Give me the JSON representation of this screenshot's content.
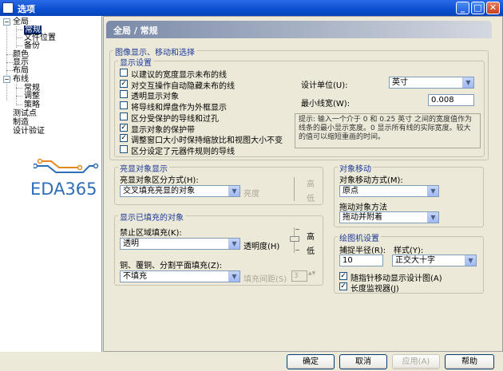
{
  "window": {
    "title": "选项"
  },
  "titlebar_buttons": {
    "minimize": "_",
    "maximize": "□",
    "close": "✕"
  },
  "tree": {
    "global": "全局",
    "general": "常规",
    "file_location": "文件位置",
    "backup": "备份",
    "color": "颜色",
    "display": "显示",
    "layer": "布局",
    "routing": "布线",
    "routing_general": "常规",
    "routing_adjust": "调整",
    "routing_strategy": "策略",
    "testpoint": "测试点",
    "fab": "制造",
    "design_verify": "设计验证",
    "expand_minus": "−"
  },
  "logo": {
    "text": "EDA365"
  },
  "panel": {
    "title": "全局 / 常规"
  },
  "image_group": {
    "title": "图像显示、移动和选择",
    "display_settings": {
      "title": "显示设置",
      "checkboxes": [
        {
          "label": "以建议的宽度显示未布的线",
          "checked": false
        },
        {
          "label": "对交互操作自动隐藏未布的线",
          "checked": true
        },
        {
          "label": "透明显示对象",
          "checked": false
        },
        {
          "label": "将导线和焊盘作为外框显示",
          "checked": false
        },
        {
          "label": "区分受保护的导线和过孔",
          "checked": false
        },
        {
          "label": "显示对象的保护带",
          "checked": true
        },
        {
          "label": "调整窗口大小时保持缩放比和视图大小不变",
          "checked": true
        },
        {
          "label": "区分设定了元器件规则的导线",
          "checked": false
        }
      ],
      "design_unit_label": "设计单位(U):",
      "design_unit_value": "英寸",
      "min_width_label": "最小线宽(W):",
      "min_width_value": "0.008",
      "hint": "提示: 输入一个介于 0 和 0.25 英寸 之间的宽度值作为线条的最小显示宽度。0 显示所有线的实际宽度。较大的值可以缩短重画的时间。"
    }
  },
  "highlight": {
    "title": "亮显对象显示",
    "mode_label": "亮显对象区分方式(H):",
    "mode_value": "交叉填充亮显的对象",
    "brightness_label": "亮度",
    "high": "高",
    "low": "低"
  },
  "object_move": {
    "title": "对象移动",
    "mode_label": "对象移动方式(M):",
    "mode_value": "原点",
    "drag_label": "拖动对象方法",
    "drag_value": "拖动并附着"
  },
  "filled_display": {
    "title": "显示已填充的对象",
    "area_fill_label": "禁止区域填充(K):",
    "area_fill_value": "透明",
    "opacity_label": "透明度(H)",
    "high": "高",
    "low": "低",
    "copper_label": "铜、覆铜、分割平面填充(Z):",
    "copper_value": "不填充",
    "spacing_label": "填充间距(S)",
    "spacing_value": "3"
  },
  "drafting": {
    "title": "绘图机设置",
    "radius_label": "捕捉半径(R):",
    "radius_value": "10",
    "style_label": "样式(Y):",
    "style_value": "正交大十字",
    "cb_pointer": {
      "label": "随指针移动显示设计图(A)",
      "checked": true
    },
    "cb_monitor": {
      "label": "长度监视器(J)",
      "checked": true
    }
  },
  "buttons": {
    "ok": "确定",
    "cancel": "取消",
    "apply": "应用(A)",
    "help": "帮助"
  },
  "check_mark": "✓",
  "dropdown_arrow": "▼",
  "spin_arrow": "▲▼"
}
